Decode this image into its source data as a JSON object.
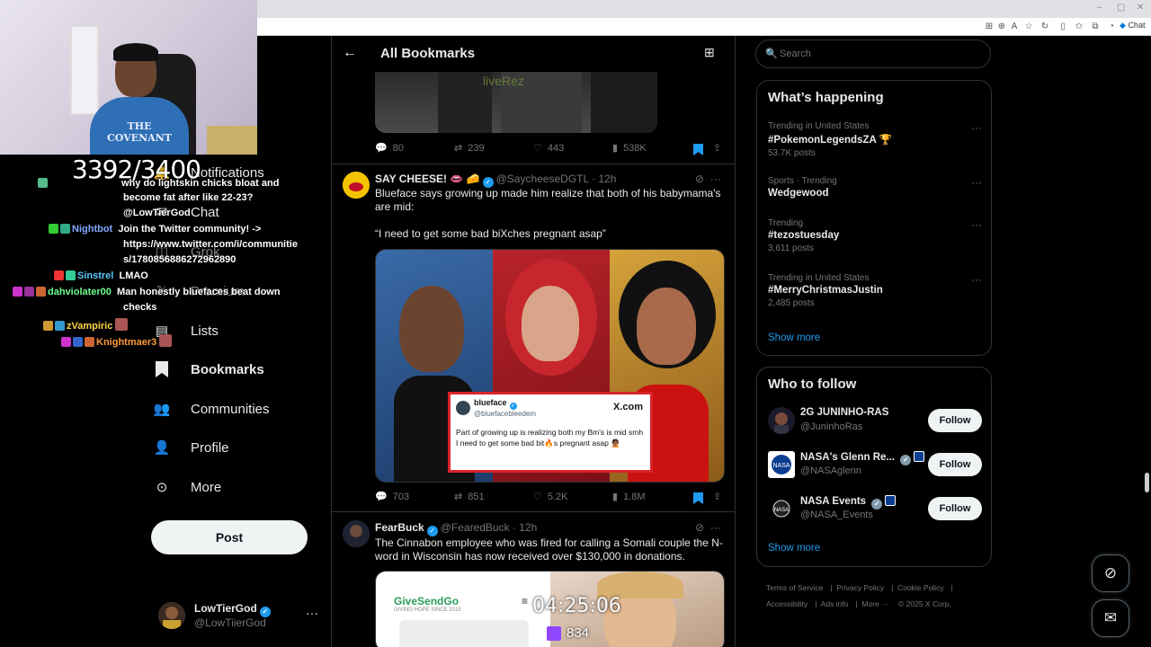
{
  "browser": {
    "chat_label": "Chat"
  },
  "stream": {
    "sub_count": "3392/3400",
    "timer": "04:25:06",
    "viewers": "834",
    "shirt_text": "THE COVENANT"
  },
  "chat": [
    {
      "user": "",
      "msg": "why do lightskin chicks bloat and",
      "color": "#a0a0ff"
    },
    {
      "user": "",
      "msg": "become fat after like 22-23?",
      "color": "#ffffff"
    },
    {
      "user": "",
      "msg": "@LowTierGod",
      "color": "#ffffff"
    },
    {
      "user": "Nightbot",
      "msg": "Join the Twitter community! ->",
      "color": "#7fa6ff"
    },
    {
      "user": "",
      "msg": "https://www.twitter.com/i/communitie",
      "color": "#ffffff"
    },
    {
      "user": "",
      "msg": "s/1780856886272962890",
      "color": "#ffffff"
    },
    {
      "user": "Sinstrel",
      "msg": "LMAO",
      "color": "#5ac8fa"
    },
    {
      "user": "dahviolater00",
      "msg": "Man honestly bluefaces beat down",
      "color": "#6dff8a"
    },
    {
      "user": "",
      "msg": "checks",
      "color": "#ffffff"
    },
    {
      "user": "zVampiric",
      "msg": "",
      "color": "#ffd84a"
    },
    {
      "user": "Knightmaer3",
      "msg": "",
      "color": "#ff9a3a"
    }
  ],
  "nav": {
    "notifications": "Notifications",
    "chat": "Chat",
    "grok": "Grok",
    "premium": "Premium",
    "lists": "Lists",
    "bookmarks": "Bookmarks",
    "communities": "Communities",
    "profile": "Profile",
    "more": "More",
    "post": "Post"
  },
  "account": {
    "name": "LowTierGod",
    "handle": "@LowTiierGod"
  },
  "feed": {
    "title": "All Bookmarks",
    "tweet0": {
      "watermark": "liveRez",
      "replies": "80",
      "reposts": "239",
      "likes": "443",
      "views": "538K"
    },
    "tweet1": {
      "name": "SAY CHEESE! 👄 🧀",
      "handle": "@SaycheeseDGTL · 12h",
      "text1": "Blueface says growing up made him realize that both of his babymama's are mid:",
      "text2": "“I need to get some bad biXches pregnant asap”",
      "quote_name": "blueface",
      "quote_handle": "@bluefacebleedem",
      "quote_x": "X.com",
      "quote_text": "Part of growing up is realizing both my Bm's is mid smh I need to get some bad bit🔥s pregnant asap 🤦🏾",
      "replies": "703",
      "reposts": "851",
      "likes": "5.2K",
      "views": "1.8M"
    },
    "tweet2": {
      "name": "FearBuck",
      "handle": "@FearedBuck · 12h",
      "text": "The Cinnabon employee who was fired for calling a Somali couple the N-word in Wisconsin has now received over $130,000 in donations.",
      "logo": "GiveSendGo",
      "logo_sub": "GIVING HOPE SINCE 2015"
    }
  },
  "right": {
    "search_placeholder": "Search",
    "happening_title": "What’s happening",
    "trends": [
      {
        "ctx": "Trending in United States",
        "title": "#PokemonLegendsZA 🏆",
        "posts": "53.7K posts"
      },
      {
        "ctx": "Sports · Trending",
        "title": "Wedgewood",
        "posts": ""
      },
      {
        "ctx": "Trending",
        "title": "#tezostuesday",
        "posts": "3,611 posts"
      },
      {
        "ctx": "Trending in United States",
        "title": "#MerryChristmasJustin",
        "posts": "2,485 posts"
      }
    ],
    "show_more": "Show more",
    "wtf_title": "Who to follow",
    "follow_label": "Follow",
    "follows": [
      {
        "name": "2G JUNINHO-RAS",
        "handle": "@JuninhoRas"
      },
      {
        "name": "NASA's Glenn Re...",
        "handle": "@NASAglenn"
      },
      {
        "name": "NASA Events",
        "handle": "@NASA_Events"
      }
    ],
    "footer": {
      "terms": "Terms of Service",
      "privacy": "Privacy Policy",
      "cookie": "Cookie Policy",
      "access": "Accessibility",
      "ads": "Ads info",
      "more": "More ···",
      "copy": "© 2025 X Corp."
    }
  }
}
